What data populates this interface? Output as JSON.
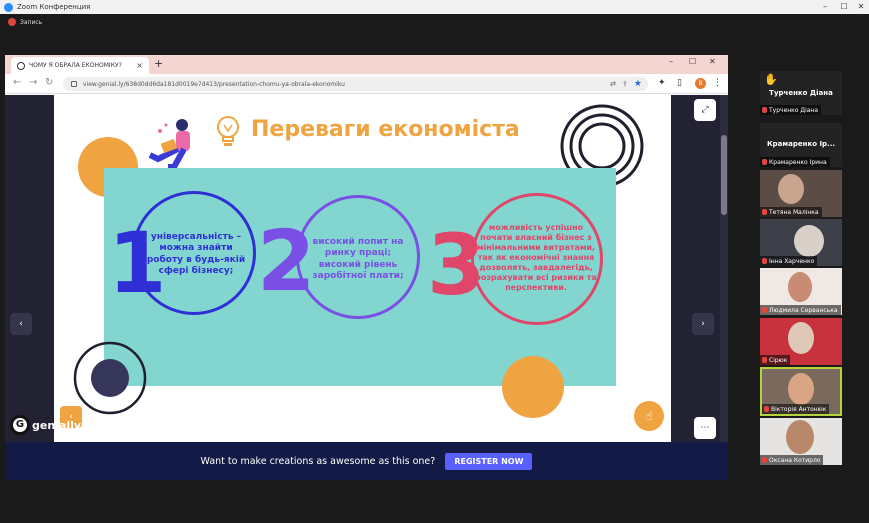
{
  "zoom": {
    "window_title": "Zoom Конференция",
    "recording_label": "Запись",
    "minimize": "–",
    "maximize": "☐",
    "close": "✕"
  },
  "browser": {
    "tab_title": "ЧОМУ Я ОБРАЛА ЕКОНОМІКУ?",
    "tab_close": "×",
    "new_tab": "+",
    "url": "view.genial.ly/638d0dd6da181d0019e7d413/presentation-chomu-ya-obrala-ekonomiku",
    "profile_initial": "B",
    "win_min": "–",
    "win_max": "☐",
    "win_close": "✕"
  },
  "slide": {
    "title": "Переваги економіста",
    "items": [
      {
        "number": "1",
        "text": "універсальність – можна знайти роботу в будь-якій сфері бізнесу;",
        "color": "#2f2fd6"
      },
      {
        "number": "2",
        "text": "високий попит на ринку праці; високий рівень заробітної плати;",
        "color": "#7a4fe6"
      },
      {
        "number": "3",
        "text": "можливість успішно почати власний бізнес з мінімальними витратами, так як економічні знання дозволять, завдалегідь, розрахувати всі ризики та перспективи.",
        "color": "#e0456a"
      }
    ]
  },
  "viewer": {
    "logo_text": "genially",
    "promo_text": "Want to make creations as awesome as this one?",
    "promo_button": "REGISTER NOW"
  },
  "participants": {
    "card1_name": "Турченко Діана",
    "card1_sub": "Турченко Діана",
    "card2_name": "Крамаренко Ір...",
    "card2_sub": "Крамаренко Ірина",
    "tiles": [
      {
        "name": "Тетяна Малінка"
      },
      {
        "name": "Інна Харченко"
      },
      {
        "name": "Людмила Серванська"
      },
      {
        "name": "Сірюк"
      },
      {
        "name": "Вікторія Антонюк"
      },
      {
        "name": "Оксана Котирло"
      }
    ]
  }
}
